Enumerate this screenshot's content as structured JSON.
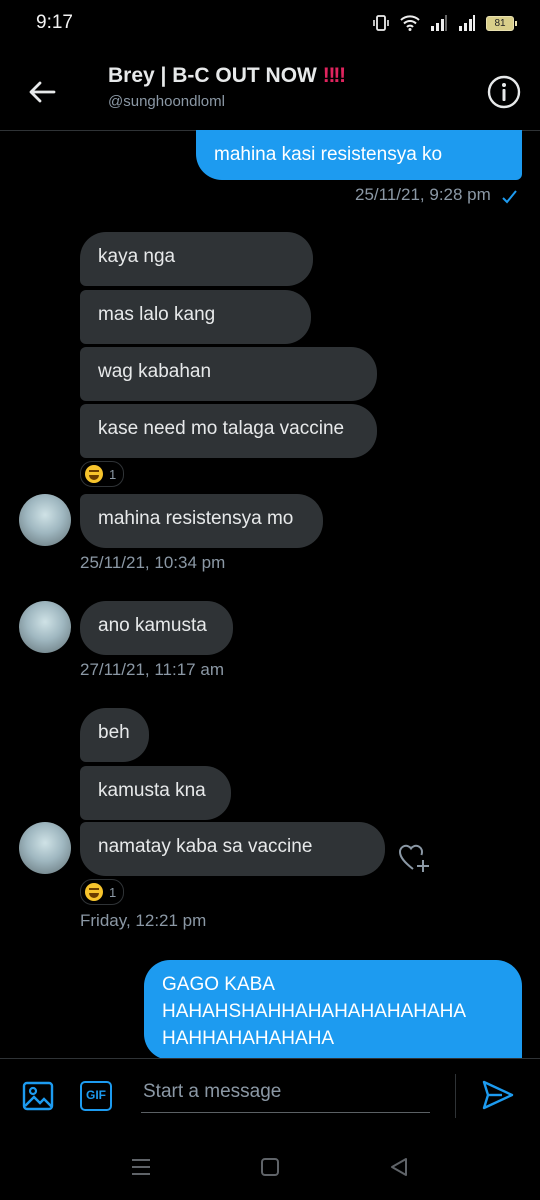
{
  "status": {
    "time": "9:17",
    "battery": "81"
  },
  "header": {
    "title": "Brey | B-C OUT NOW",
    "title_emoji": "‼‼",
    "handle": "@sunghoondloml"
  },
  "messages": {
    "m1": {
      "text": "mahina kasi resistensya ko",
      "time": "25/11/21, 9:28 pm"
    },
    "m2": {
      "text": "kaya nga"
    },
    "m3": {
      "text": "mas lalo kang"
    },
    "m4": {
      "text": "wag kabahan"
    },
    "m5": {
      "text": "kase need mo talaga vaccine",
      "reaction_count": "1"
    },
    "m6": {
      "text": "mahina resistensya mo",
      "time": "25/11/21, 10:34 pm"
    },
    "m7": {
      "text": "ano kamusta",
      "time": "27/11/21, 11:17 am"
    },
    "m8": {
      "text": "beh"
    },
    "m9": {
      "text": "kamusta kna"
    },
    "m10": {
      "text": "namatay kaba sa vaccine",
      "reaction_count": "1",
      "time": "Friday, 12:21 pm"
    },
    "m11": {
      "line1": "GAGO KABA",
      "line2": "HAHAHSHAHHAHAHAHAHAHAHA",
      "line3": "HAHHAHAHAHAHA"
    }
  },
  "composer": {
    "placeholder": "Start a message",
    "gif_label": "GIF"
  },
  "colors": {
    "accent": "#1d9bf0",
    "incoming_bubble": "#2f3336",
    "background": "#000000"
  }
}
